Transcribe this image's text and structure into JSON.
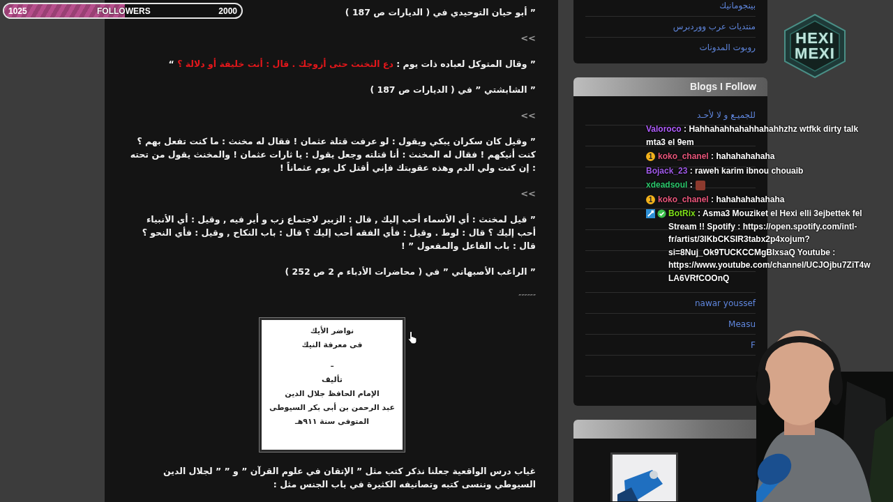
{
  "follower_goal": {
    "current": "1025",
    "label": "FOLLOWERS",
    "target": "2000",
    "level": 0.51
  },
  "article": {
    "blocks": [
      {
        "kind": "text",
        "text": "” أبو حيان التوحيدي في ( الديارات ص 187 )"
      },
      {
        "kind": "separator",
        "text": "<<"
      },
      {
        "kind": "mixed",
        "segments": [
          {
            "text": "” وقال المتوكل لعباده ذات يوم : ",
            "highlighted": false
          },
          {
            "text": "دع التخنث حتى أزوجك . قال : أنت خليفة أو دلالة ؟",
            "highlighted": true
          },
          {
            "text": " “",
            "highlighted": false
          }
        ]
      },
      {
        "kind": "text",
        "text": "” الشابشتي ” في ( الديارات  ص 187 )"
      },
      {
        "kind": "separator",
        "text": "<<"
      },
      {
        "kind": "text",
        "text": "” وقيل كان سكران يبكي ويقول : لو عرفت قتلة عثمان ! فقال له مخنث : ما كنت تفعل بهم ؟ كنت أنيكهم ! فقال له المخنث : أنا قتلته وجعل يقول : يا ثارات عثمان ! والمخنث يقول من تحته : إن كنت ولي الدم وهذه عقوبتك فإني أقتل كل يوم عثماناً !"
      },
      {
        "kind": "separator",
        "text": "<<"
      },
      {
        "kind": "text",
        "text": "” قيل لمخنث : أي الأسماء أحب إليك , قال : الزبير لاجتماع زب و أير فيه , وقيل : أي الأنبياء أحب إليك ؟ قال : لوط . وقيل : فأي الفقه أحب إليك ؟ قال : باب النكاح , وقيل : فأي النحو ؟ قال : باب الفاعل والمفعول ” !"
      },
      {
        "kind": "text",
        "text": "” الراغب الأصبهاني ” في ( محاضرات الأدباء م 2 ص  252 )"
      },
      {
        "kind": "marks",
        "text": "″″″″″″"
      },
      {
        "lines": [
          "نواضر الأيك",
          "فى معرفة النيك",
          "ـ",
          "تأليف",
          "الإمام الحافظ جلال الدين",
          "عبد الرحمن بن أبى بكر السيوطى",
          "المتوفى سنة ٩١١هـ"
        ]
      },
      {
        "kind": "text",
        "text": "غياب درس الواقعية جعلنا نذكر كتب مثل ” الإتقان في علوم القرآن ” و ”   ” لجلال الدين السيوطي وننسى  كتبه وتصانيفه الكثيرة في باب الجنس مثل :"
      }
    ]
  },
  "sidebar": {
    "links": [
      "بينجومانيك",
      "منتديات عرب ووردبرس",
      "روبوت المدونات"
    ],
    "blogs_widget": {
      "title": "Blogs I Follow",
      "items": [
        "للجميـع و لا لأحـد",
        "nawar youssef",
        "Measu",
        "F"
      ]
    }
  },
  "logo": {
    "lines": [
      "HEXI",
      "MEXI"
    ]
  },
  "chat": {
    "messages": [
      {
        "user": "Valoroco",
        "color": "#b15dff",
        "separator": ":",
        "text": "Hahhahahhahahhahahhzhz wtfkk dirty talk mta3 el 9em"
      },
      {
        "badges": [
          {
            "kind": "sub",
            "label": "1"
          }
        ],
        "user": "koko_chanel",
        "color": "#e8557a",
        "separator": ":",
        "text": "hahahahahaha"
      },
      {
        "user": "Bojack_23",
        "color": "#a05ae8",
        "separator": ":",
        "text": "raweh karim ibnou chouaib"
      },
      {
        "user": "xdeadsoul",
        "color": "#2cc76c",
        "separator": ":",
        "emote": true
      },
      {
        "badges": [
          {
            "kind": "sub",
            "label": "1"
          }
        ],
        "user": "koko_chanel",
        "color": "#e8557a",
        "separator": ":",
        "text": "hahahahahahaha"
      },
      {
        "badges": [
          {
            "kind": "mod"
          },
          {
            "kind": "verified"
          }
        ],
        "user": "BotRix",
        "color": "#7fe01a",
        "separator": ":",
        "text": "Asma3 Mouziket el Hexi elli 3ejbettek fel Stream !! Spotify : https://open.spotify.com/intl-fr/artist/3lKbCKSIR3tabx2p4xojum?si=8Nuj_Ok9TUCKCCMgBIxsaQ Youtube : https://www.youtube.com/channel/UCJOjbu7ZiT4wLA6VRfCOOnQ"
      }
    ]
  }
}
